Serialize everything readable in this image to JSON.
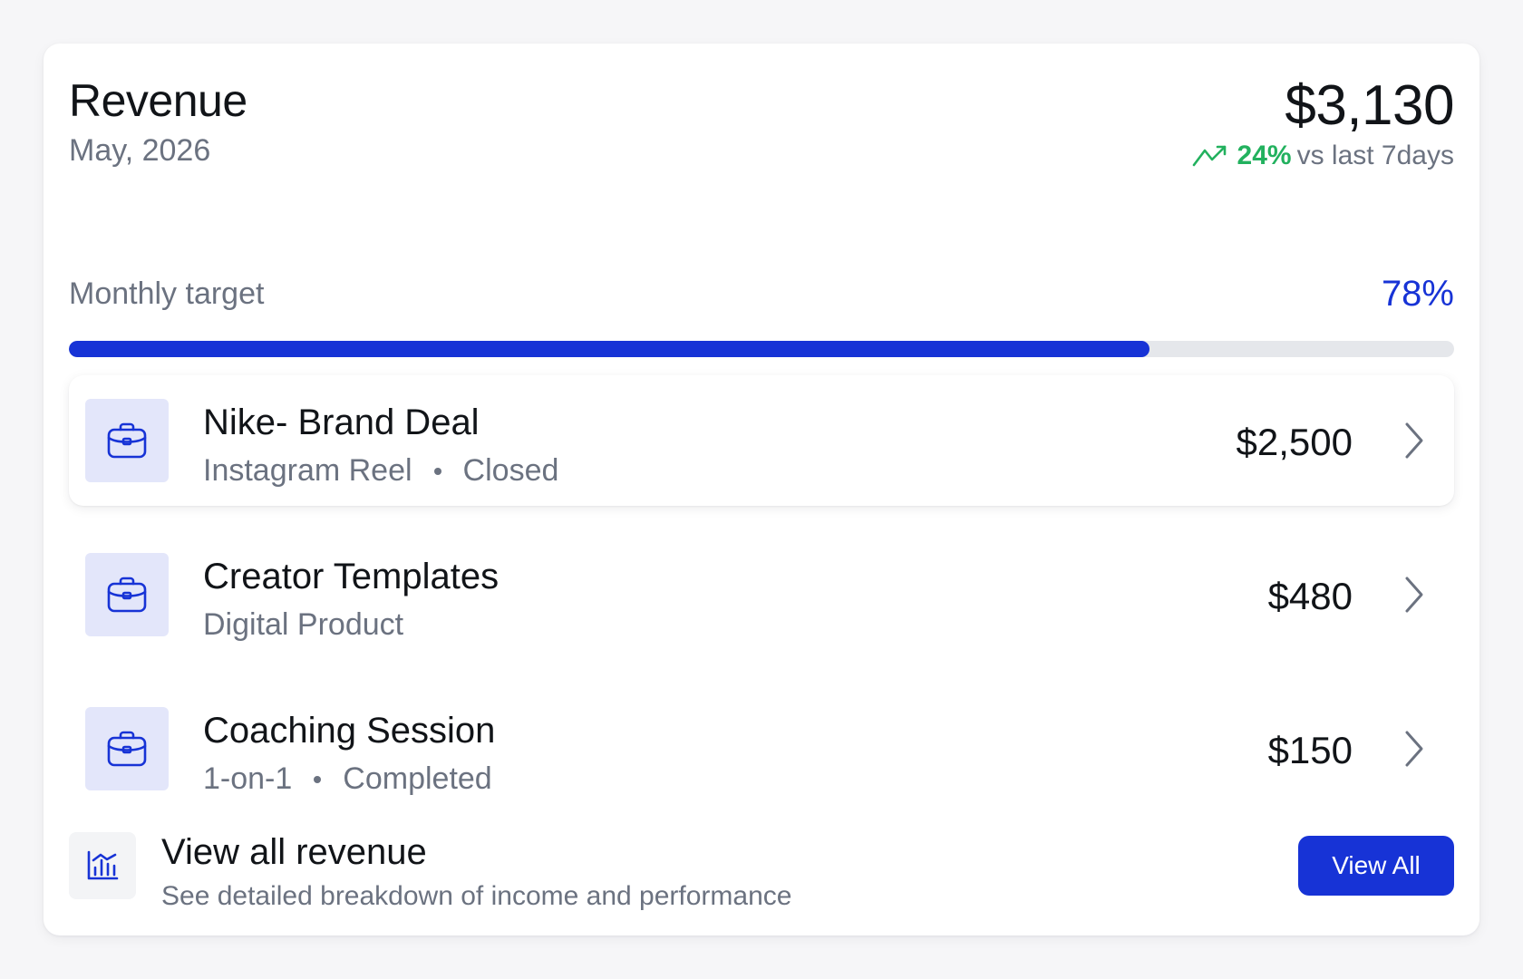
{
  "colors": {
    "accent": "#1733d6",
    "positive": "#22b15e",
    "icon_bg": "#e3e6fa",
    "muted_text": "#6b7280"
  },
  "header": {
    "title": "Revenue",
    "period": "May, 2026",
    "total": "$3,130",
    "trend": {
      "icon": "trend-up-icon",
      "percent": "24%",
      "comparison": "vs last 7days"
    }
  },
  "target": {
    "label": "Monthly target",
    "percent_label": "78%",
    "progress": 0.78
  },
  "items": [
    {
      "icon": "briefcase-icon",
      "title": "Nike- Brand Deal",
      "type": "Instagram Reel",
      "status": "Closed",
      "amount": "$2,500",
      "active": true
    },
    {
      "icon": "briefcase-icon",
      "title": "Creator Templates",
      "type": "Digital Product",
      "status": "",
      "amount": "$480",
      "active": false
    },
    {
      "icon": "briefcase-icon",
      "title": "Coaching Session",
      "type": "1-on-1",
      "status": "Completed",
      "amount": "$150",
      "active": false
    }
  ],
  "footer": {
    "icon": "bar-chart-icon",
    "title": "View all revenue",
    "subtitle": "See detailed breakdown of income and performance",
    "button_label": "View All"
  }
}
